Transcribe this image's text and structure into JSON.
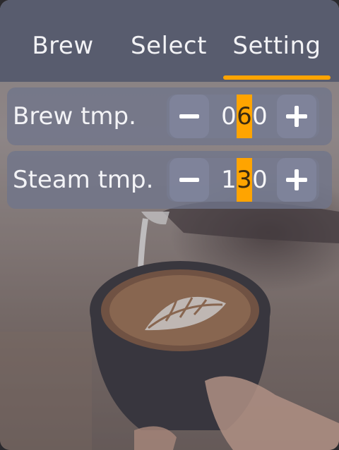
{
  "tabs": [
    {
      "label": "Brew"
    },
    {
      "label": "Select"
    },
    {
      "label": "Setting",
      "active": true
    }
  ],
  "settings": [
    {
      "label": "Brew tmp.",
      "digits": [
        "0",
        "6",
        "0"
      ],
      "selected_digit": 1
    },
    {
      "label": "Steam tmp.",
      "digits": [
        "1",
        "3",
        "0"
      ],
      "selected_digit": 1
    }
  ],
  "icons": {
    "decrement": "minus-icon",
    "increment": "plus-icon"
  },
  "colors": {
    "accent": "#ffa400",
    "tabbar": "#585c6e",
    "row": "#70748a"
  }
}
